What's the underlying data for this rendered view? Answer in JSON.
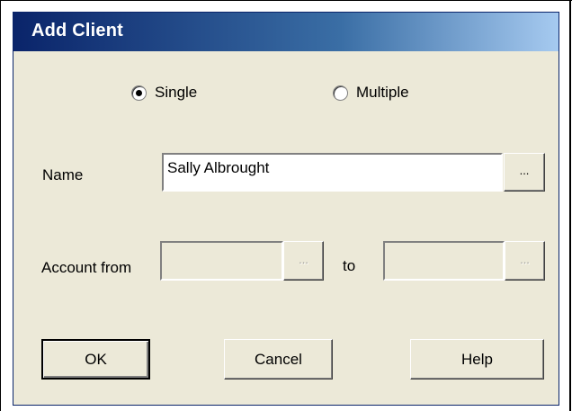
{
  "dialog": {
    "title": "Add Client",
    "mode_options": [
      {
        "label": "Single",
        "selected": true
      },
      {
        "label": "Multiple",
        "selected": false
      }
    ],
    "name_field": {
      "label": "Name",
      "value": "Sally Albrought",
      "browse_label": "..."
    },
    "account_range": {
      "from_label": "Account from",
      "from_value": "",
      "to_label": "to",
      "to_value": "",
      "browse_label": "...",
      "enabled": false
    },
    "buttons": {
      "ok": "OK",
      "cancel": "Cancel",
      "help": "Help"
    },
    "colors": {
      "titlebar_start": "#0a246a",
      "titlebar_end": "#a6caf0",
      "dialog_bg": "#ece9d8"
    }
  }
}
